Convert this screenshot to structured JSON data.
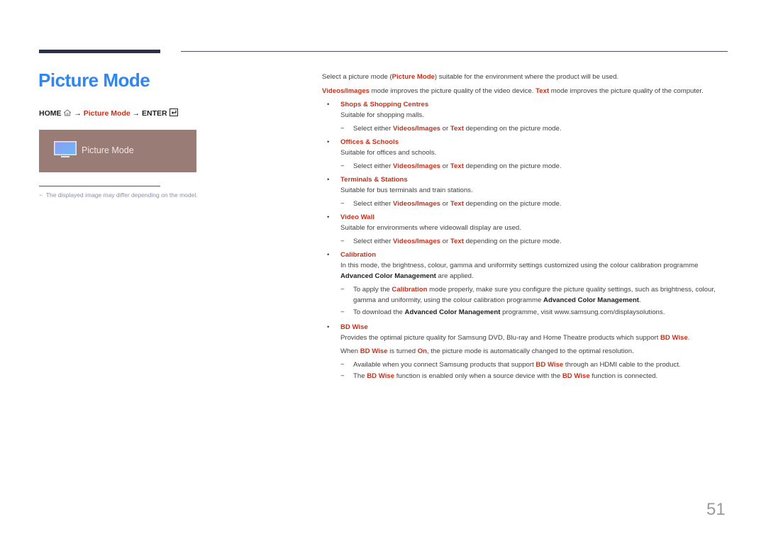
{
  "page": {
    "title": "Picture Mode",
    "page_number": "51"
  },
  "nav": {
    "home": "HOME",
    "arrow1": "→",
    "picture_mode": "Picture Mode",
    "arrow2": "→",
    "enter": "ENTER"
  },
  "panel": {
    "label": "Picture Mode",
    "colors": {
      "background": "#9a7c77"
    }
  },
  "note": "The displayed image may differ depending on the model.",
  "intro": {
    "line1_pre": "Select a picture mode (",
    "line1_hl": "Picture Mode",
    "line1_post": ") suitable for the environment where the product will be used.",
    "line2_hl1": "Videos/Images",
    "line2_mid": " mode improves the picture quality of the video device. ",
    "line2_hl2": "Text",
    "line2_post": " mode improves the picture quality of the computer."
  },
  "modes": [
    {
      "title": "Shops & Shopping Centres",
      "desc": "Suitable for shopping malls.",
      "note_pre": "Select either ",
      "note_hl1": "Videos/Images",
      "note_mid": " or ",
      "note_hl2": "Text",
      "note_post": " depending on the picture mode."
    },
    {
      "title": "Offices & Schools",
      "desc": "Suitable for offices and schools.",
      "note_pre": "Select either ",
      "note_hl1": "Videos/Images",
      "note_mid": " or ",
      "note_hl2": "Text",
      "note_post": " depending on the picture mode."
    },
    {
      "title": "Terminals & Stations",
      "desc": "Suitable for bus terminals and train stations.",
      "note_pre": "Select either ",
      "note_hl1": "Videos/Images",
      "note_mid": " or ",
      "note_hl2": "Text",
      "note_post": " depending on the picture mode."
    },
    {
      "title": "Video Wall",
      "desc": "Suitable for environments where videowall display are used.",
      "note_pre": "Select either ",
      "note_hl1": "Videos/Images",
      "note_mid": " or ",
      "note_hl2": "Text",
      "note_post": " depending on the picture mode."
    }
  ],
  "calibration": {
    "title": "Calibration",
    "desc_pre": "In this mode, the brightness, colour, gamma and uniformity settings customized using the colour calibration programme ",
    "desc_bold": "Advanced Color Management",
    "desc_post": " are applied.",
    "note1_pre": "To apply the ",
    "note1_hl": "Calibration",
    "note1_mid": " mode properly, make sure you configure the picture quality settings, such as brightness, colour, gamma and uniformity, using the colour calibration programme ",
    "note1_bold": "Advanced Color Management",
    "note1_post": ".",
    "note2_pre": "To download the ",
    "note2_bold": "Advanced Color Management",
    "note2_post": " programme, visit www.samsung.com/displaysolutions."
  },
  "bdwise": {
    "title": "BD Wise",
    "desc1_pre": "Provides the optimal picture quality for Samsung DVD, Blu-ray and Home Theatre products which support ",
    "desc1_hl": "BD Wise",
    "desc1_post": ".",
    "desc2_pre": "When ",
    "desc2_hl1": "BD Wise",
    "desc2_mid": " is turned ",
    "desc2_hl2": "On",
    "desc2_post": ", the picture mode is automatically changed to the optimal resolution.",
    "note1_pre": "Available when you connect Samsung products that support ",
    "note1_hl": "BD Wise",
    "note1_post": " through an HDMI cable to the product.",
    "note2_pre": "The ",
    "note2_hl1": "BD Wise",
    "note2_mid": " function is enabled only when a source device with the ",
    "note2_hl2": "BD Wise",
    "note2_post": " function is connected."
  },
  "symbols": {
    "bullet": "•",
    "dash": "−"
  },
  "colors": {
    "title": "#2f86f0",
    "highlight": "#c8301a",
    "bar": "#2c2f4a"
  }
}
